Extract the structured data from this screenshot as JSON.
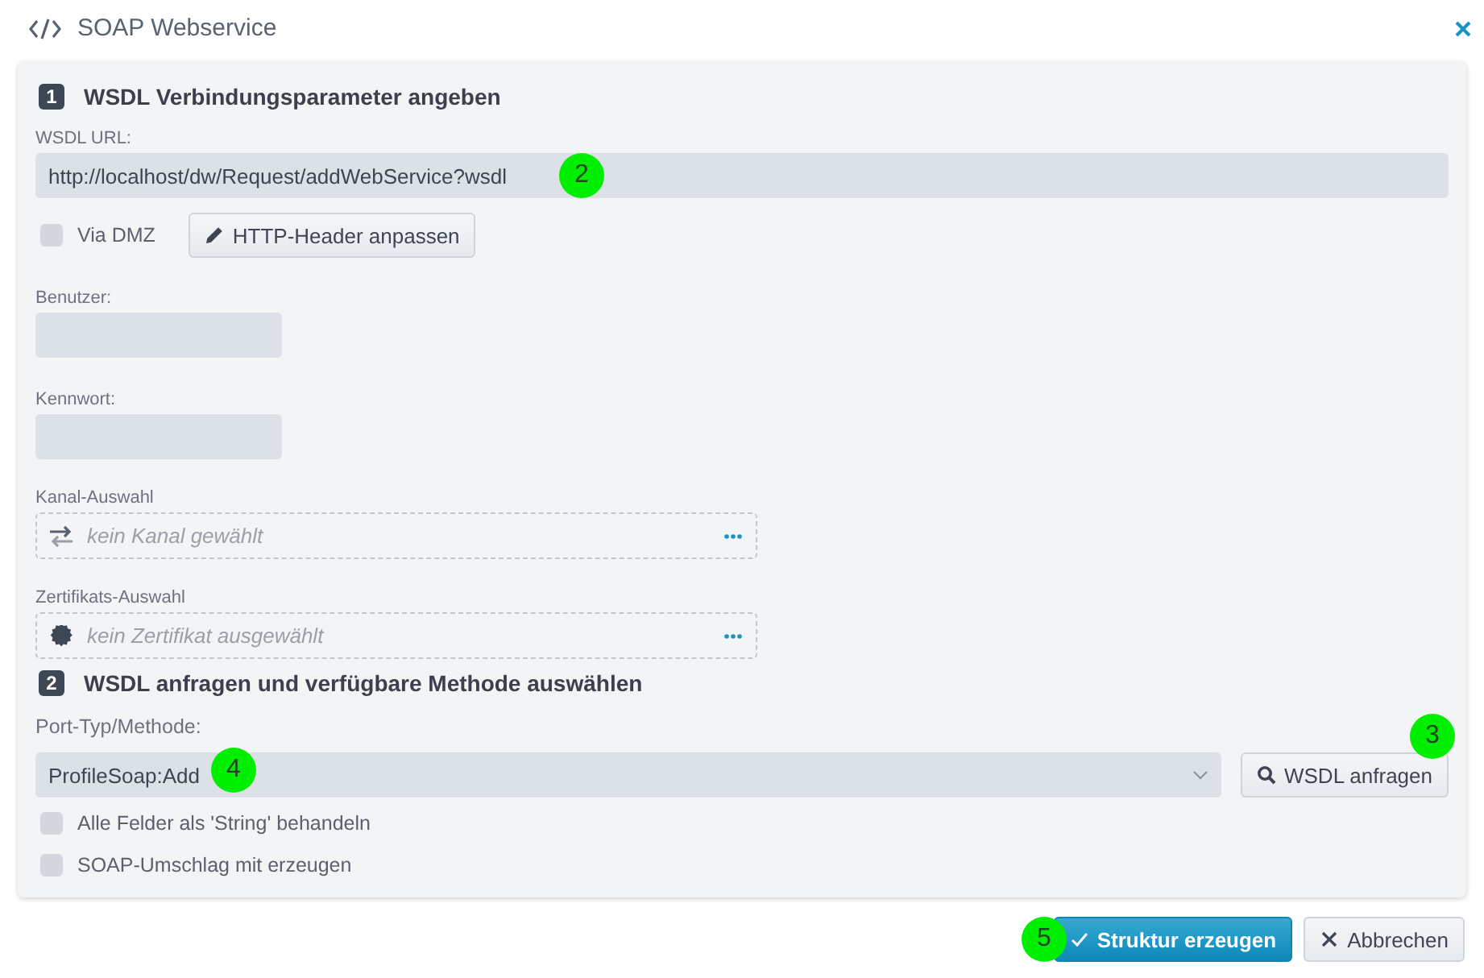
{
  "window": {
    "title": "SOAP Webservice"
  },
  "section1": {
    "number": "1",
    "title": "WSDL Verbindungsparameter angeben",
    "url": {
      "label": "WSDL URL:",
      "value": "http://localhost/dw/Request/addWebService?wsdl"
    },
    "dmz": {
      "label": "Via DMZ",
      "checked": false
    },
    "header_button": "HTTP-Header anpassen",
    "user": {
      "label": "Benutzer:"
    },
    "password": {
      "label": "Kennwort:"
    },
    "pickers": [
      {
        "label": "Kanal-Auswahl",
        "kind": "channel",
        "placeholder": "kein Kanal gewählt"
      },
      {
        "label": "Zertifikats-Auswahl",
        "kind": "certificate",
        "placeholder": "kein Zertifikat ausgewählt"
      }
    ]
  },
  "section2": {
    "number": "2",
    "title": "WSDL anfragen und verfügbare Methode auswählen",
    "port": {
      "label": "Port-Typ/Methode:",
      "value": "ProfileSoap:Add"
    },
    "query_button": "WSDL anfragen",
    "options": [
      {
        "label": "Alle Felder als 'String' behandeln",
        "checked": false
      },
      {
        "label": "SOAP-Umschlag mit erzeugen",
        "checked": false
      }
    ]
  },
  "buttons": [
    {
      "label": "Struktur erzeugen",
      "kind": "primary"
    },
    {
      "label": "Abbrechen",
      "kind": "cancel"
    }
  ],
  "markers": [
    "2",
    "3",
    "4",
    "5"
  ]
}
